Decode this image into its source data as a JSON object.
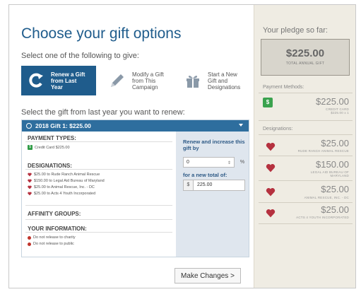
{
  "page": {
    "title": "Choose your gift options",
    "subtitle": "Select one of the following to give:",
    "select_label": "Select the gift from last year you want to renew:"
  },
  "options": [
    {
      "label": "Renew a Gift\nfrom Last\nYear",
      "icon": "renew-icon",
      "active": true
    },
    {
      "label": "Modify a Gift\nfrom This\nCampaign",
      "icon": "pencil-icon",
      "active": false
    },
    {
      "label": "Start a New\nGift and\nDesignations",
      "icon": "gift-icon",
      "active": false
    }
  ],
  "gift_panel": {
    "header": "2018 Gift 1: $225.00",
    "payment_types_heading": "PAYMENT TYPES:",
    "payment_item": "Credit Card $225.00",
    "designations_heading": "DESIGNATIONS:",
    "designations": [
      "$25.00 to Rude Ranch Animal Rescue",
      "$150.00 to Legal Aid Bureau of Maryland",
      "$25.00 to Animal Rescue, Inc. - DC",
      "$25.00 to Acts 4 Youth Incorporated"
    ],
    "affinity_heading": "AFFINITY GROUPS:",
    "your_info_heading": "YOUR INFORMATION:",
    "info_items": [
      "Do not release to charity",
      "Do not release to public"
    ],
    "renew_label": "Renew and increase this gift by",
    "increase_value": "0",
    "percent_symbol": "%",
    "new_total_label": "for a new total of:",
    "currency_symbol": "$",
    "new_total_value": "225.00"
  },
  "make_changes_label": "Make Changes >",
  "sidebar": {
    "title": "Your pledge so far:",
    "total_amount": "$225.00",
    "total_label": "TOTAL ANNUAL GIFT",
    "payment_methods_heading": "Payment Methods:",
    "payment_badge": "$",
    "payment_amount": "$225.00",
    "payment_sub": "CREDIT CARD\n$225.00 x 1",
    "designations_heading": "Designations:",
    "designations": [
      {
        "amount": "$25.00",
        "name": "RUDE RANCH ANIMAL RESCUE"
      },
      {
        "amount": "$150.00",
        "name": "LEGAL AID BUREAU OF\nMARYLAND"
      },
      {
        "amount": "$25.00",
        "name": "ANIMAL RESCUE, INC. - DC"
      },
      {
        "amount": "$25.00",
        "name": "ACTS 4 YOUTH INCORPORATED"
      }
    ]
  },
  "colors": {
    "primary": "#1f5c8c",
    "panel_header": "#2e6e9e",
    "heart": "#b5313f",
    "success": "#3aa24e",
    "sidebar_bg": "#efece3"
  }
}
